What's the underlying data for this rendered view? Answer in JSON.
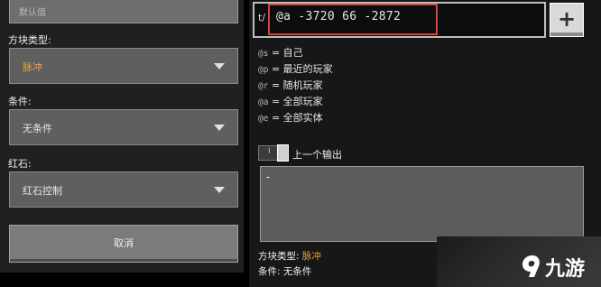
{
  "left_panel": {
    "top_field_value": "默认值",
    "block_type": {
      "label": "方块类型:",
      "value": "脉冲"
    },
    "condition": {
      "label": "条件:",
      "value": "无条件"
    },
    "redstone": {
      "label": "红石:",
      "value": "红石控制"
    },
    "cancel_label": "取消"
  },
  "command": {
    "prefix": "t/",
    "value": "@a -3720 66 -2872",
    "add_label": "+"
  },
  "selectors": [
    {
      "code": "@s",
      "desc": "= 自己"
    },
    {
      "code": "@p",
      "desc": "= 最近的玩家"
    },
    {
      "code": "@r",
      "desc": "= 随机玩家"
    },
    {
      "code": "@a",
      "desc": "= 全部玩家"
    },
    {
      "code": "@e",
      "desc": "= 全部实体"
    }
  ],
  "previous_output": {
    "toggle_mark": "I",
    "label": "上一个输出",
    "content": "-"
  },
  "info": {
    "block_type_label": "方块类型:",
    "block_type_value": "脉冲",
    "condition_label": "条件:",
    "condition_value": "无条件"
  },
  "watermark": {
    "text": "九游",
    "icon": "nine-game-logo-icon"
  },
  "colors": {
    "accent_orange": "#e8a33d",
    "highlight_red": "#d5453f"
  }
}
